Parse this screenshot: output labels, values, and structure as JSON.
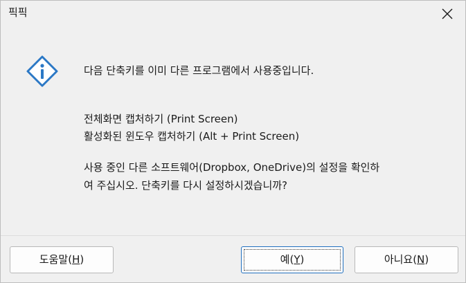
{
  "window": {
    "title": "픽픽",
    "close_icon": "close-icon"
  },
  "icon": {
    "name": "info-icon",
    "color": "#2b78c5"
  },
  "message": {
    "main": "다음 단축키를 이미 다른 프로그램에서 사용중입니다.",
    "line1": "전체화면 캡처하기 (Print Screen)",
    "line2": "활성화된 윈도우 캡처하기 (Alt + Print Screen)",
    "note_line1": "사용 중인 다른 소프트웨어(Dropbox, OneDrive)의 설정을 확인하",
    "note_line2": "여 주십시오. 단축키를 다시 설정하시겠습니까?"
  },
  "buttons": {
    "help": {
      "label": "도움말(",
      "mnemonic": "H",
      "suffix": ")"
    },
    "yes": {
      "label": "예(",
      "mnemonic": "Y",
      "suffix": ")"
    },
    "no": {
      "label": "아니요(",
      "mnemonic": "N",
      "suffix": ")"
    }
  }
}
